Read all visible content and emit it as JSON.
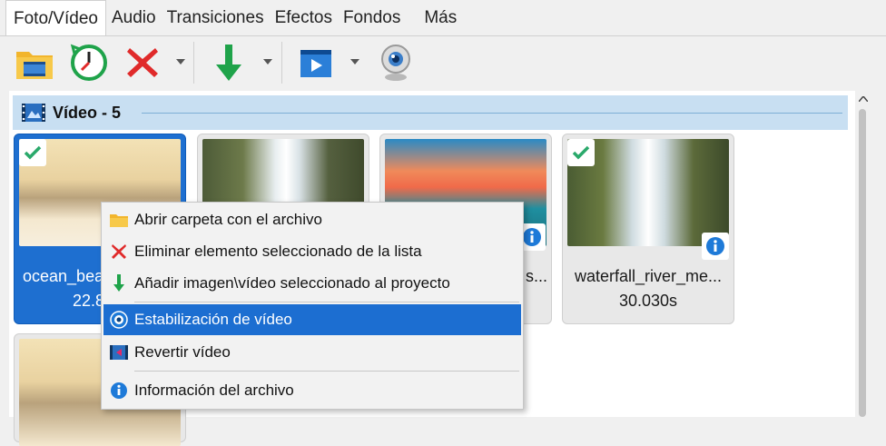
{
  "tabs": [
    {
      "label": "Foto/Vídeo",
      "active": true
    },
    {
      "label": "Audio",
      "active": false
    },
    {
      "label": "Transiciones",
      "active": false
    },
    {
      "label": "Efectos",
      "active": false
    },
    {
      "label": "Fondos",
      "active": false
    },
    {
      "label": "Más",
      "active": false
    }
  ],
  "toolbar": {
    "buttons": [
      {
        "icon": "folder-film-icon"
      },
      {
        "icon": "clock-history-icon"
      },
      {
        "icon": "delete-x-icon"
      },
      {
        "icon": "add-down-arrow-icon"
      },
      {
        "icon": "video-play-icon"
      },
      {
        "icon": "webcam-icon"
      }
    ]
  },
  "group": {
    "title": "Vídeo - 5",
    "icon": "video-film-icon"
  },
  "tiles": [
    {
      "name": "ocean_bea",
      "duration": "22.8",
      "selected": true,
      "checked": true,
      "info": false
    },
    {
      "name": "",
      "duration": "",
      "selected": false,
      "checked": false,
      "info": false
    },
    {
      "name": "s...",
      "duration": "",
      "selected": false,
      "checked": false,
      "info": true
    },
    {
      "name": "waterfall_river_me...",
      "duration": "30.030s",
      "selected": false,
      "checked": true,
      "info": true
    }
  ],
  "context_menu": {
    "items": [
      {
        "label": "Abrir carpeta con el archivo",
        "icon": "folder-icon",
        "highlighted": false
      },
      {
        "label": "Eliminar elemento seleccionado de la lista",
        "icon": "red-x-icon",
        "highlighted": false
      },
      {
        "label": "Añadir imagen\\vídeo seleccionado al proyecto",
        "icon": "green-down-arrow-icon",
        "highlighted": false
      },
      {
        "label": "Estabilización de vídeo",
        "icon": "stabilize-eye-icon",
        "highlighted": true
      },
      {
        "label": "Revertir vídeo",
        "icon": "reverse-film-icon",
        "highlighted": false
      },
      {
        "label": "Información del archivo",
        "icon": "info-circle-icon",
        "highlighted": false
      }
    ]
  },
  "colors": {
    "accent": "#1c6ed1",
    "group_header_bg": "#c8dff2",
    "check_green": "#2aa96b",
    "delete_red": "#e02a2a",
    "arrow_green": "#1fa34a"
  }
}
